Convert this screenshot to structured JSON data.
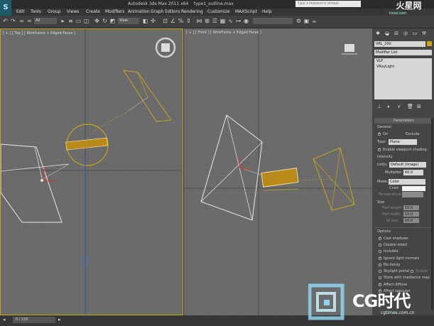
{
  "app": {
    "title": "Autodesk 3ds Max 2011 x64",
    "file": "type1_outline.max",
    "search_placeholder": "Type a keyword or phrase",
    "logo_text": "S",
    "brand": "火星网",
    "brand_url": "hxsd.com"
  },
  "menu": [
    "Edit",
    "Tools",
    "Group",
    "Views",
    "Create",
    "Modifiers",
    "Animation",
    "Graph Editors",
    "Rendering",
    "Customize",
    "MAXScript",
    "Help"
  ],
  "toolbar": {
    "selection_filter": "All",
    "ref_coord": "View"
  },
  "viewports": {
    "top": {
      "label": "[ + ] [ Top ] [ Wireframe + Edged Faces ]"
    },
    "front": {
      "label": "[ + ] [ Front ] [ Wireframe + Edged Faces ]"
    }
  },
  "command_panel": {
    "object_name": "VRL_200",
    "modifier_list": "Modifier List",
    "stack": [
      "VLP",
      "VRayLight"
    ],
    "rollout_title": "Parameters",
    "general_label": "General",
    "on_label": "On",
    "exclude_label": "Exclude",
    "type_label": "Type:",
    "type_value": "Plane",
    "viewport_shading": "Enable viewport shading",
    "intensity_label": "Intensity",
    "units_label": "Units:",
    "units_value": "Default (image)",
    "multiplier_label": "Multiplier:",
    "multiplier_value": "60.0",
    "mode_label": "Mode:",
    "mode_value": "Color",
    "color_label": "Color:",
    "temperature_label": "Temperature:",
    "temperature_value": "6500.0",
    "size_label": "Size",
    "half_length_label": "Half-length:",
    "half_length_value": "15.0",
    "half_width_label": "Half-width:",
    "half_width_value": "15.0",
    "w_size_label": "W size:",
    "w_size_value": "10.0",
    "options_label": "Options",
    "options": [
      {
        "label": "Cast shadows",
        "on": true
      },
      {
        "label": "Double-sided",
        "on": false
      },
      {
        "label": "Invisible",
        "on": false
      },
      {
        "label": "Ignore light normals",
        "on": true
      },
      {
        "label": "No decay",
        "on": false
      },
      {
        "label": "Skylight portal",
        "on": false
      },
      {
        "label": "Store with irradiance map",
        "on": false
      },
      {
        "label": "Affect diffuse",
        "on": true
      },
      {
        "label": "Affect specular",
        "on": true
      }
    ],
    "simple_label": "Simple"
  },
  "status": {
    "frame": "0 / 100"
  },
  "watermark": {
    "text": "CG时代",
    "url": "cgtimes.com.cn"
  },
  "colors": {
    "selection": "#c9a41f",
    "viewport_bg": "#6a6a6a",
    "grid": "#777777"
  }
}
